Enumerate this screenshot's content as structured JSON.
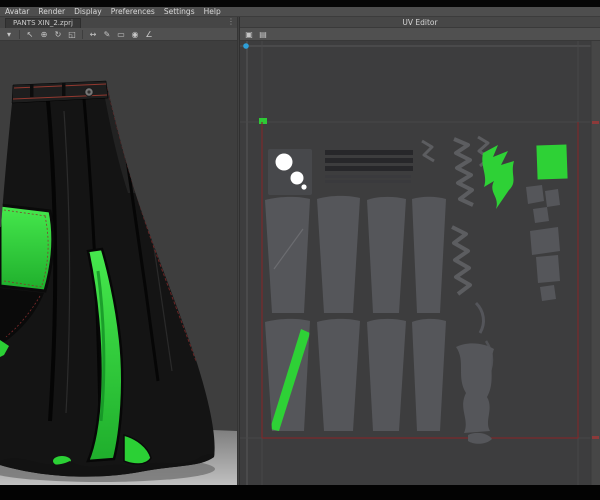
{
  "menu": {
    "items": [
      "Avatar",
      "Render",
      "Display",
      "Preferences",
      "Settings",
      "Help"
    ]
  },
  "tabs": {
    "project": "PANTS XIN_2.zprj"
  },
  "uv_editor": {
    "title": "UV Editor"
  },
  "icons": {
    "view_dropdown": "▾",
    "select": "↖",
    "move": "⊕",
    "rotate": "↻",
    "scale": "◱",
    "pan": "↔",
    "pen": "✎",
    "rect_tool": "▭",
    "pin": "◉",
    "measure": "∠",
    "uv_tool_1": "▣",
    "uv_tool_2": "▤",
    "panel_handle": "⋮"
  },
  "colors": {
    "accent_green": "#2ed136",
    "stitch_red": "#8c2f2f",
    "island_gray": "#55565a",
    "uv_tile_border_red": "#7c2a2c",
    "ruler_dot_blue": "#2e9fd8",
    "viewport_bg": "#3e3e3e"
  }
}
